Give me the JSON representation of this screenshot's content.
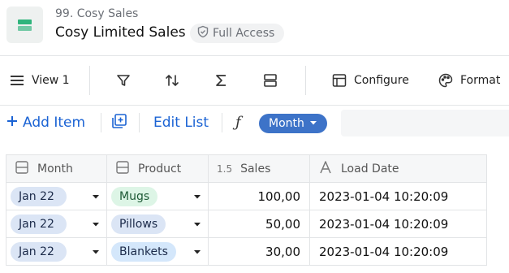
{
  "header": {
    "breadcrumb": "99. Cosy Sales",
    "title": "Cosy Limited Sales",
    "access_badge": "Full Access"
  },
  "toolbar": {
    "view_label": "View 1",
    "configure_label": "Configure",
    "format_label": "Format",
    "icons": [
      "menu-icon",
      "filter-icon",
      "sort-icon",
      "sum-icon",
      "group-icon",
      "table-icon",
      "palette-icon"
    ]
  },
  "actions": {
    "add_item_label": "Add Item",
    "edit_list_label": "Edit List",
    "formula_symbol": "ƒ",
    "month_chip_label": "Month"
  },
  "grid": {
    "columns": [
      {
        "label": "Month",
        "type_icon": "list-icon"
      },
      {
        "label": "Product",
        "type_icon": "list-icon"
      },
      {
        "label": "Sales",
        "type_icon": "1.5"
      },
      {
        "label": "Load Date",
        "type_icon": "text-icon"
      }
    ],
    "rows": [
      {
        "month": "Jan 22",
        "product": "Mugs",
        "sales": "100,00",
        "load_date": "2023-01-04 10:20:09"
      },
      {
        "month": "Jan 22",
        "product": "Pillows",
        "sales": "50,00",
        "load_date": "2023-01-04 10:20:09"
      },
      {
        "month": "Jan 22",
        "product": "Blankets",
        "sales": "30,00",
        "load_date": "2023-01-04 10:20:09"
      }
    ]
  },
  "colors": {
    "accent_blue": "#1b63d4",
    "chip_blue": "#3d73c8",
    "app_icon_green": "#2fb47c"
  }
}
